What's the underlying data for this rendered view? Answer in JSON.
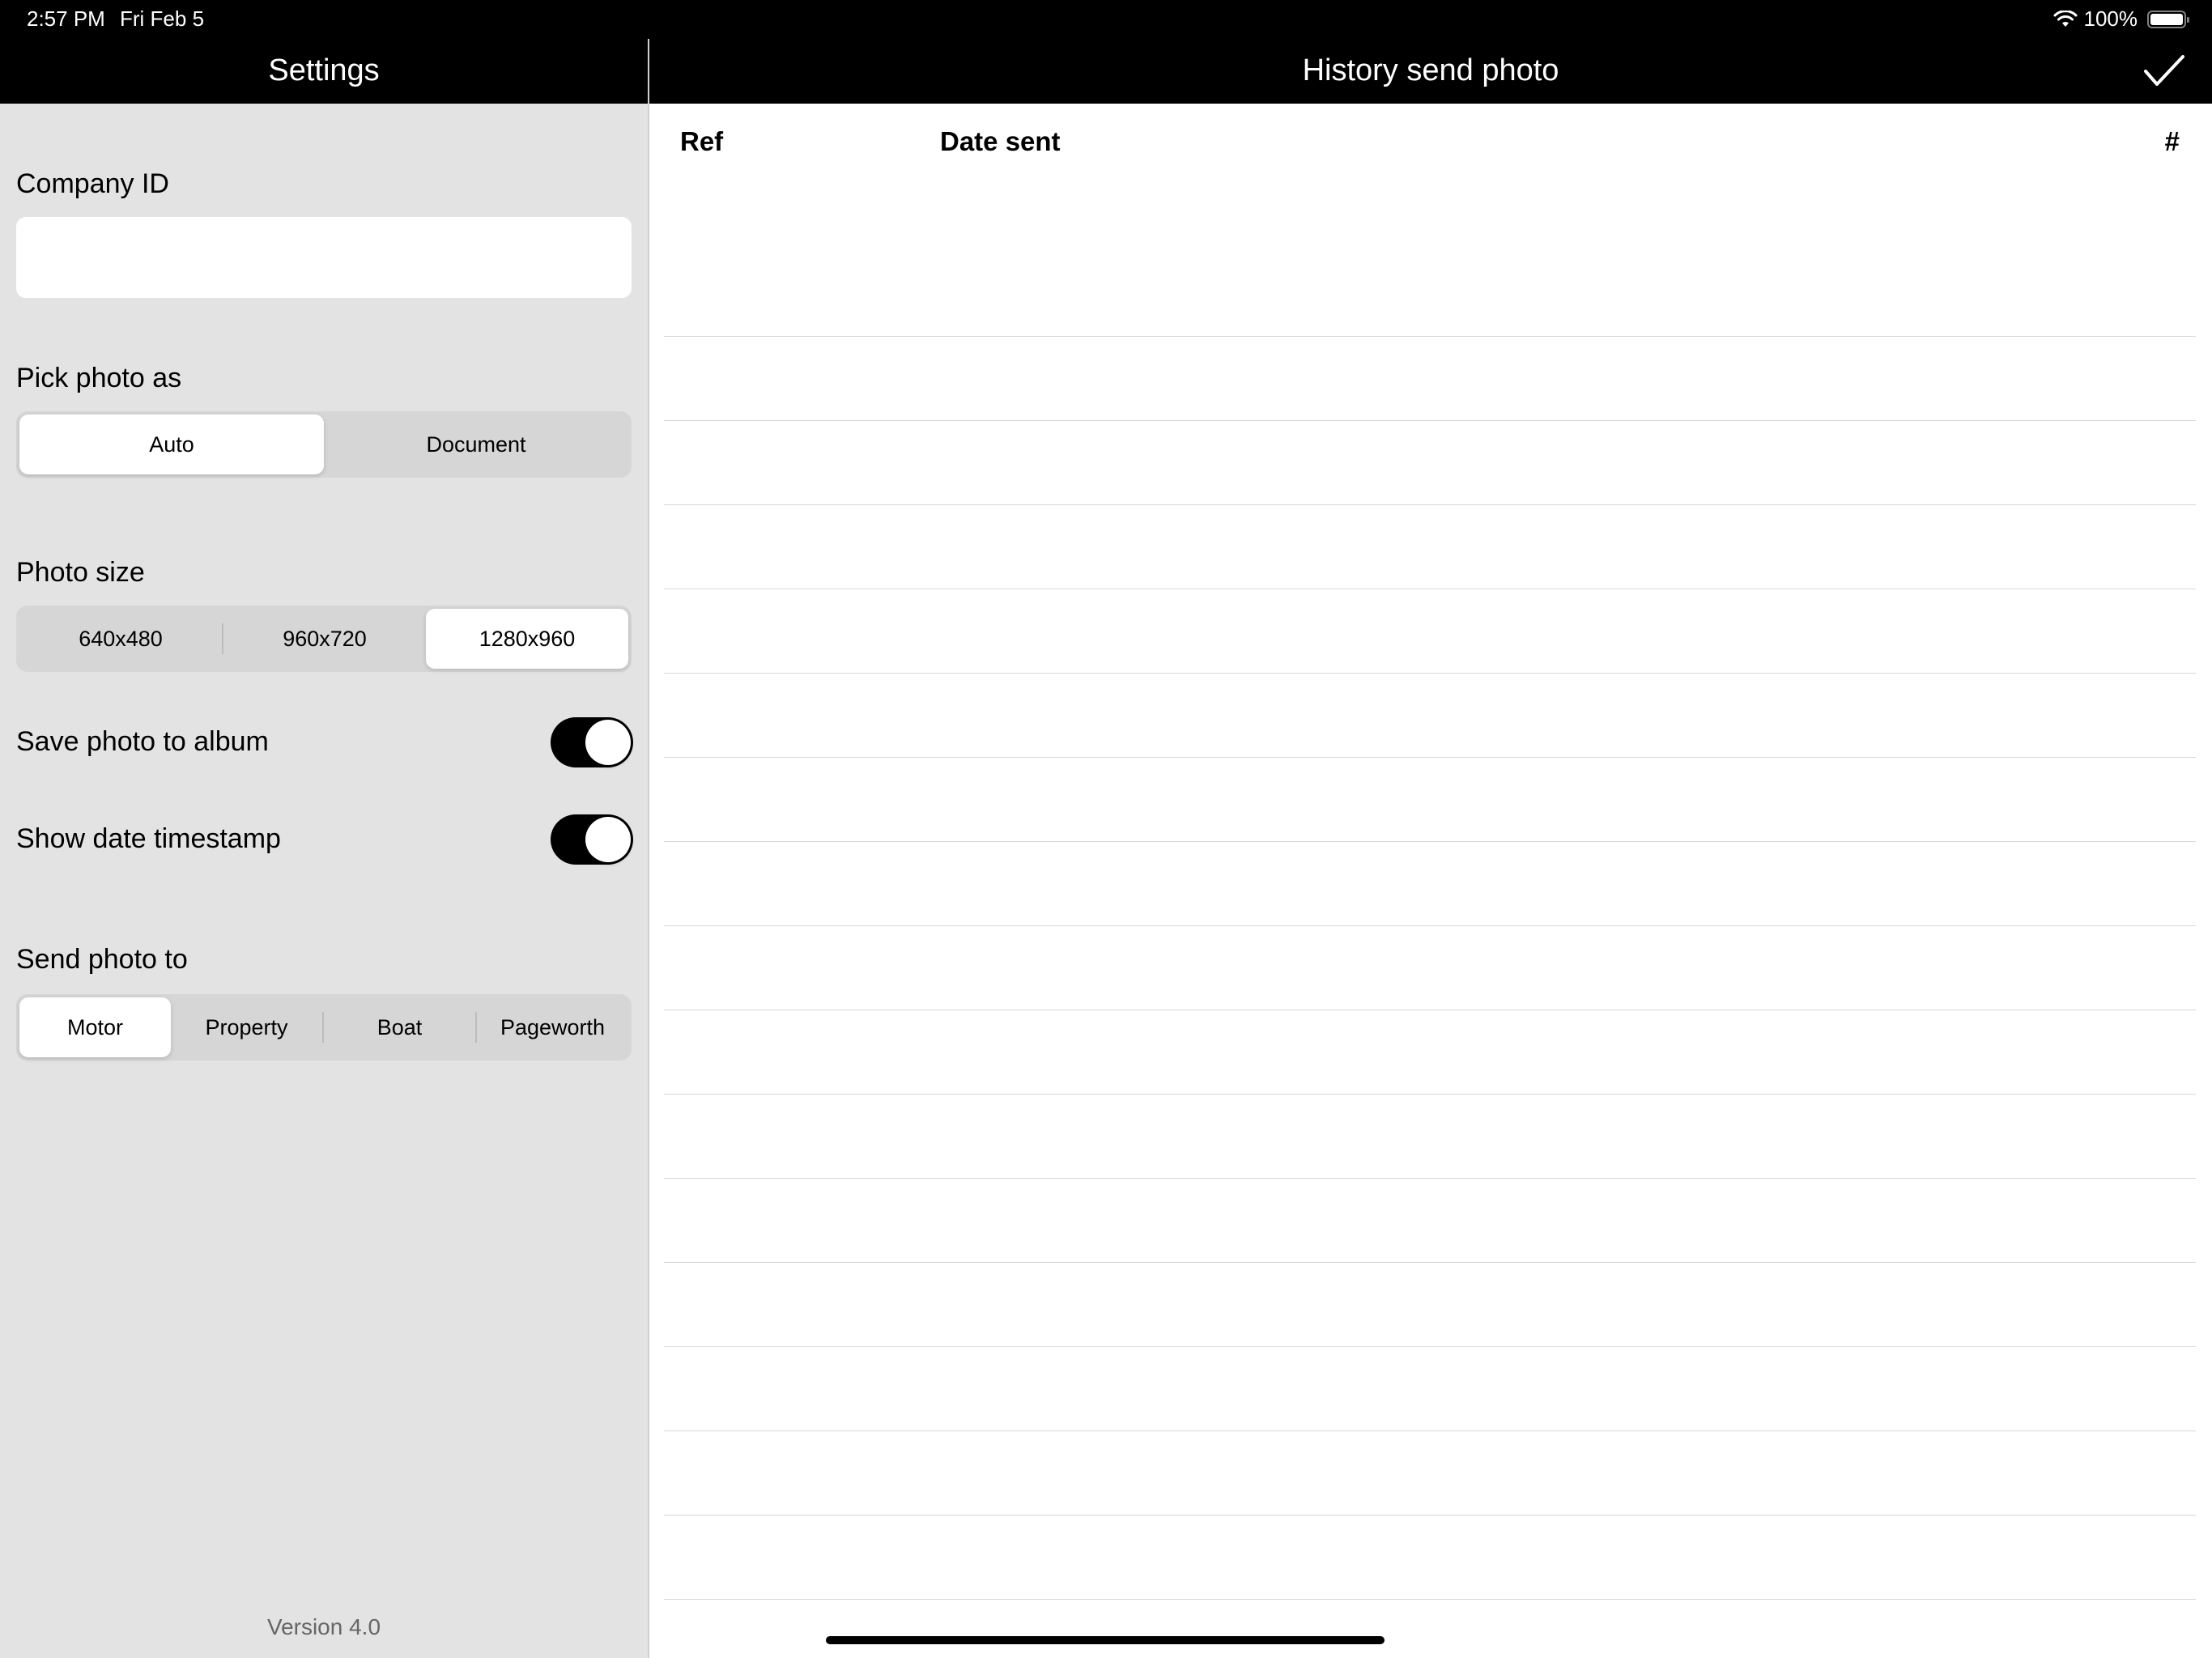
{
  "status_bar": {
    "time": "2:57 PM",
    "date": "Fri Feb 5",
    "battery": "100%"
  },
  "settings": {
    "title": "Settings",
    "company_id": {
      "label": "Company ID",
      "value": "",
      "placeholder": ""
    },
    "pick_photo_as": {
      "label": "Pick photo as",
      "options": [
        "Auto",
        "Document"
      ],
      "selected": "Auto"
    },
    "photo_size": {
      "label": "Photo size",
      "options": [
        "640x480",
        "960x720",
        "1280x960"
      ],
      "selected": "1280x960"
    },
    "save_photo_to_album": {
      "label": "Save photo to album",
      "on": true
    },
    "show_date_timestamp": {
      "label": "Show date timestamp",
      "on": true
    },
    "send_photo_to": {
      "label": "Send photo to",
      "options": [
        "Motor",
        "Property",
        "Boat",
        "Pageworth"
      ],
      "selected": "Motor"
    },
    "version": "Version 4.0"
  },
  "history": {
    "title": "History send photo",
    "columns": {
      "ref": "Ref",
      "date_sent": "Date sent",
      "count": "#"
    },
    "rows": []
  },
  "colors": {
    "nav_background": "#000000",
    "panel_background": "#e3e3e3",
    "toggle_on": "#000000"
  }
}
